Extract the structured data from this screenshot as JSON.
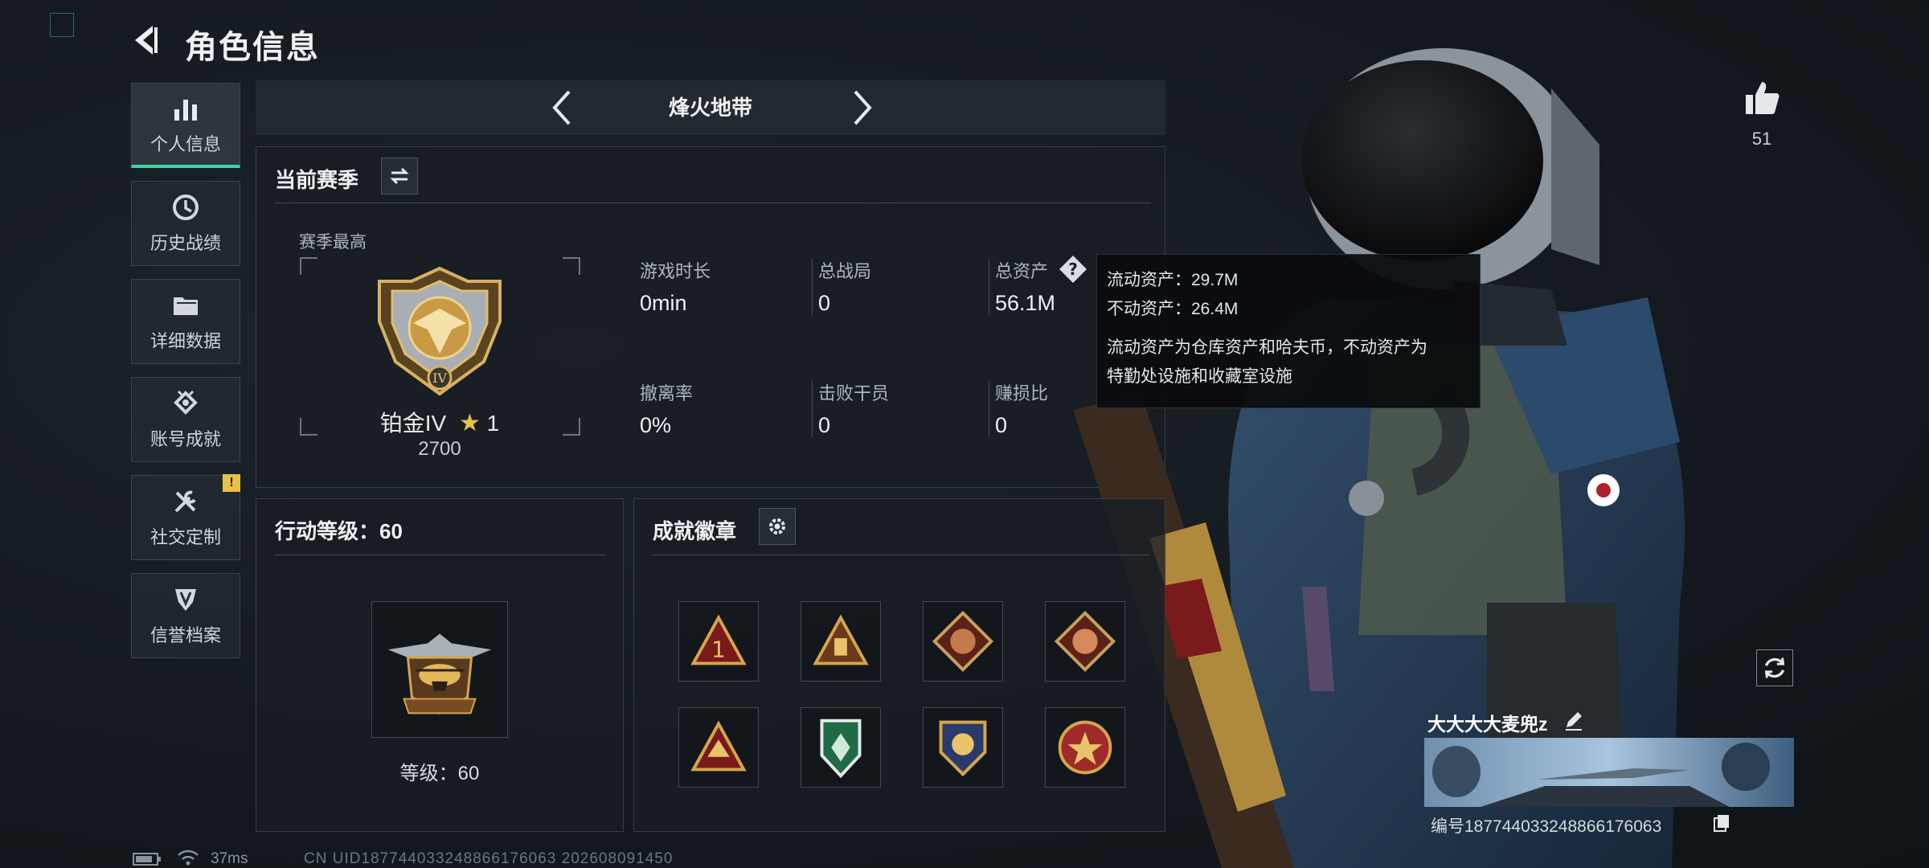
{
  "header": {
    "title": "角色信息"
  },
  "sidebar": {
    "items": [
      {
        "label": "个人信息",
        "icon": "bar-chart-icon",
        "active": true
      },
      {
        "label": "历史战绩",
        "icon": "clock-icon"
      },
      {
        "label": "详细数据",
        "icon": "folder-icon"
      },
      {
        "label": "账号成就",
        "icon": "achievement-icon"
      },
      {
        "label": "社交定制",
        "icon": "tools-icon",
        "badge": "!"
      },
      {
        "label": "信誉档案",
        "icon": "shield-icon"
      }
    ]
  },
  "mode": {
    "title": "烽火地带"
  },
  "season": {
    "title": "当前赛季",
    "best_label": "赛季最高",
    "rank_name": "铂金IV",
    "rank_stars": "1",
    "rank_score": "2700",
    "stats": [
      {
        "label": "游戏时长",
        "value": "0min"
      },
      {
        "label": "总战局",
        "value": "0"
      },
      {
        "label": "总资产",
        "value": "56.1M"
      },
      {
        "label": "撤离率",
        "value": "0%"
      },
      {
        "label": "击败干员",
        "value": "0"
      },
      {
        "label": "赚损比",
        "value": "0"
      }
    ]
  },
  "tooltip": {
    "liquid": "流动资产：29.7M",
    "fixed": "不动资产：26.4M",
    "desc_line1": "流动资产为仓库资产和哈夫币，不动资产为",
    "desc_line2": "特勤处设施和收藏室设施"
  },
  "action_level": {
    "title": "行动等级：60",
    "level_label": "等级：60"
  },
  "badges": {
    "title": "成就徽章",
    "items": [
      "badge-1",
      "badge-2",
      "badge-3",
      "badge-4",
      "badge-5",
      "badge-6",
      "badge-7",
      "badge-8"
    ]
  },
  "likes": {
    "count": "51"
  },
  "name_card": {
    "name": "大大大大麦兜z",
    "id": "编号1877440332488661​76063"
  },
  "status_bar": {
    "ping": "37ms",
    "uid": "CN UID1877440332488661​76063 20260809​1450"
  },
  "colors": {
    "accent": "#38d9a0",
    "badge": "#e8c14a",
    "gold": "#c9a04a"
  }
}
